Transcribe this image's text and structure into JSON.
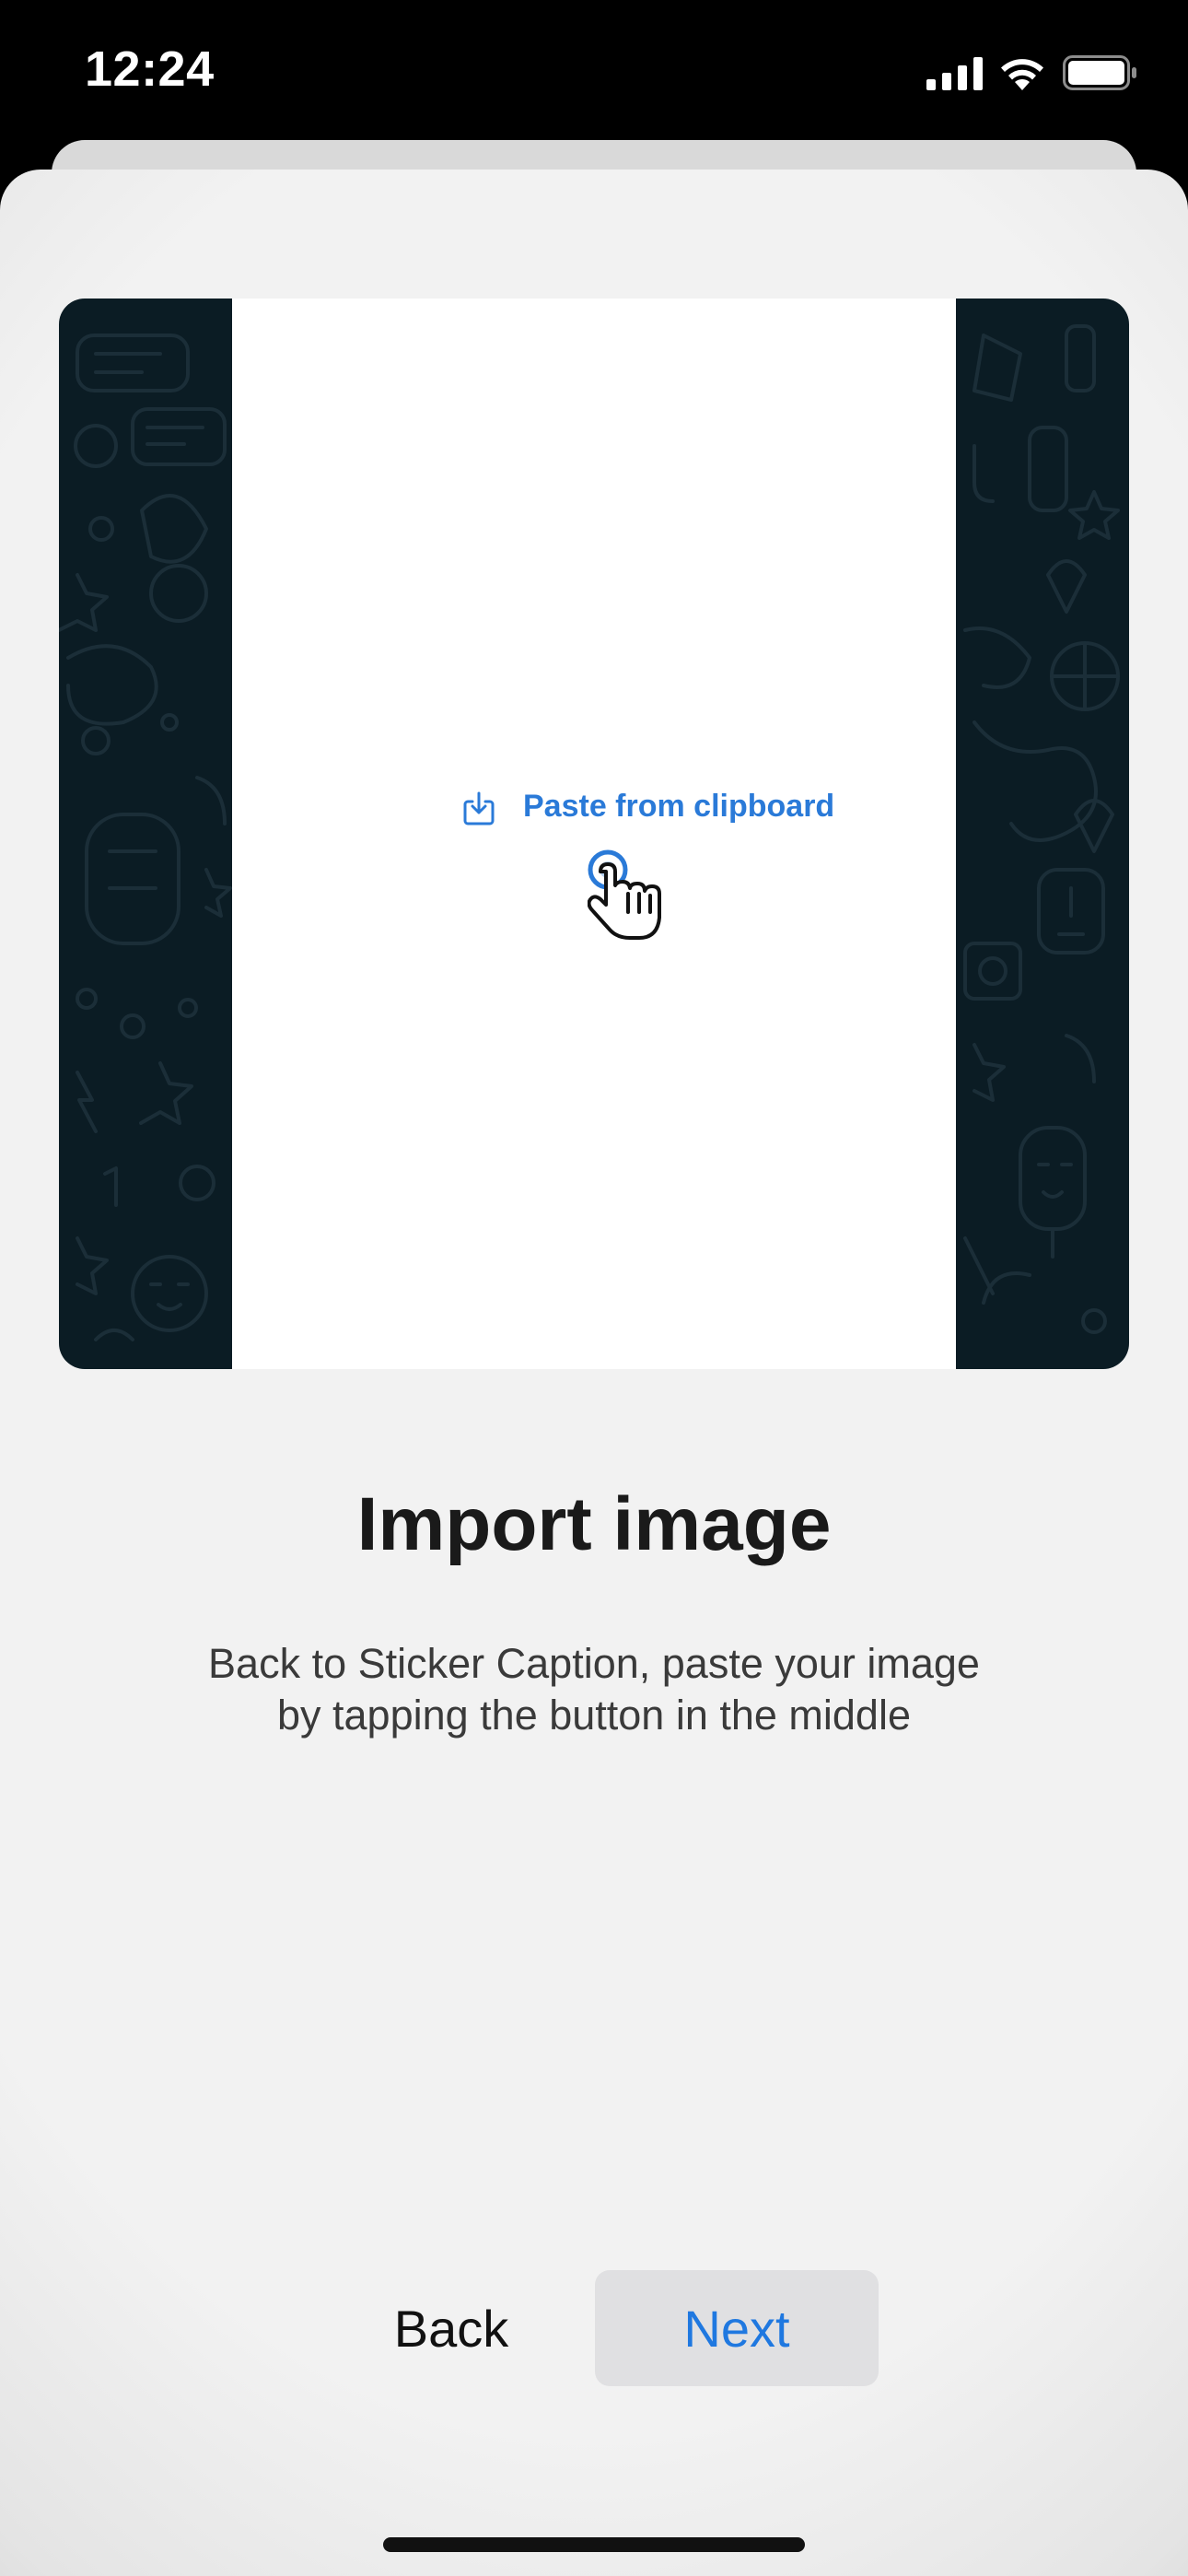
{
  "status_bar": {
    "time": "12:24",
    "icons": [
      "cellular-signal-icon",
      "wifi-icon",
      "battery-icon"
    ]
  },
  "preview": {
    "paste_button_label": "Paste from clipboard",
    "paste_icon": "download-tray-icon",
    "cursor_icon": "hand-pointer-icon"
  },
  "content": {
    "title": "Import image",
    "subtitle_line1": "Back to Sticker Caption, paste your image",
    "subtitle_line2": "by tapping the button in the middle"
  },
  "actions": {
    "back_label": "Back",
    "next_label": "Next"
  },
  "colors": {
    "accent": "#1f78e0",
    "preview_background": "#0b1c24",
    "sheet_background": "#f2f2f2"
  }
}
